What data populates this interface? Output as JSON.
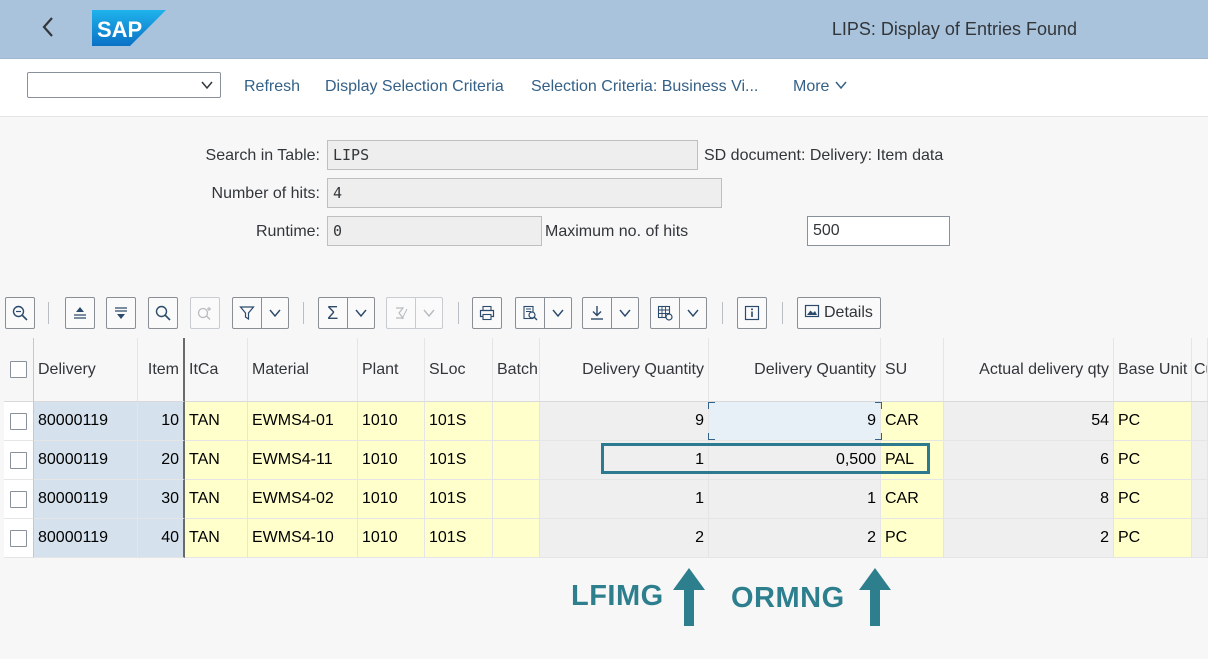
{
  "header": {
    "title": "LIPS: Display of Entries Found",
    "logo_text": "SAP"
  },
  "toolbar": {
    "variant_value": "",
    "refresh": "Refresh",
    "display_selection_criteria": "Display Selection Criteria",
    "selection_criteria_business": "Selection Criteria: Business Vi...",
    "more": "More"
  },
  "form": {
    "search_label": "Search in Table:",
    "search_value": "LIPS",
    "search_desc": "SD document: Delivery: Item data",
    "hits_label": "Number of hits:",
    "hits_value": "4",
    "runtime_label": "Runtime:",
    "runtime_value": "0",
    "max_hits_label": "Maximum no. of hits",
    "max_hits_value": "500"
  },
  "alv_toolbar": {
    "details": "Details",
    "sum_symbol": "Σ"
  },
  "table": {
    "headers": {
      "delivery": "Delivery",
      "item": "Item",
      "itca": "ItCa",
      "material": "Material",
      "plant": "Plant",
      "sloc": "SLoc",
      "batch": "Batch",
      "dq1": "Delivery Quantity",
      "dq2": "Delivery Quantity",
      "su": "SU",
      "actual": "Actual delivery qty",
      "base_unit": "Base Unit",
      "cu": "Cu"
    },
    "rows": [
      {
        "delivery": "80000119",
        "item": "10",
        "itca": "TAN",
        "material": "EWMS4-01",
        "plant": "1010",
        "sloc": "101S",
        "batch": "",
        "dq1": "9",
        "dq2": "9",
        "su": "CAR",
        "actual": "54",
        "base_unit": "PC"
      },
      {
        "delivery": "80000119",
        "item": "20",
        "itca": "TAN",
        "material": "EWMS4-11",
        "plant": "1010",
        "sloc": "101S",
        "batch": "",
        "dq1": "1",
        "dq2": "0,500",
        "su": "PAL",
        "actual": "6",
        "base_unit": "PC"
      },
      {
        "delivery": "80000119",
        "item": "30",
        "itca": "TAN",
        "material": "EWMS4-02",
        "plant": "1010",
        "sloc": "101S",
        "batch": "",
        "dq1": "1",
        "dq2": "1",
        "su": "CAR",
        "actual": "8",
        "base_unit": "PC"
      },
      {
        "delivery": "80000119",
        "item": "40",
        "itca": "TAN",
        "material": "EWMS4-10",
        "plant": "1010",
        "sloc": "101S",
        "batch": "",
        "dq1": "2",
        "dq2": "2",
        "su": "PC",
        "actual": "2",
        "base_unit": "PC"
      }
    ]
  },
  "annotations": {
    "lfimg": "LFIMG",
    "ormng": "ORMNG"
  },
  "colors": {
    "shell_bg": "#a9c3dc",
    "key_column": "#d5e1ec",
    "yellow_column": "#ffffcc",
    "annotation": "#2d7f8e"
  }
}
